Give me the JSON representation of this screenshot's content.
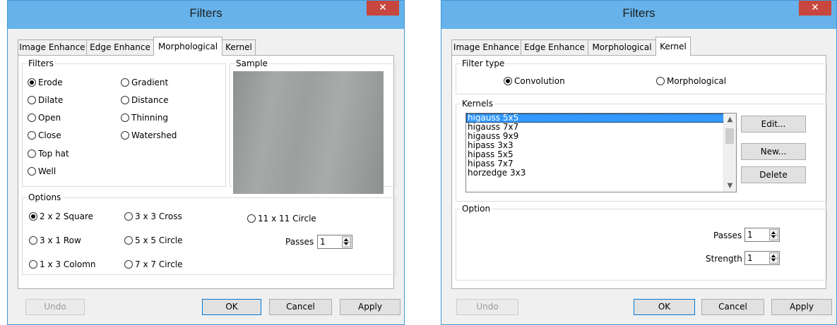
{
  "left_dialog": {
    "title": "Filters",
    "close_glyph": "✕",
    "tabs": [
      {
        "label": "Image Enhance",
        "active": false
      },
      {
        "label": "Edge Enhance",
        "active": false
      },
      {
        "label": "Morphological",
        "active": true
      },
      {
        "label": "Kernel",
        "active": false
      }
    ],
    "filters_group": {
      "title": "Filters",
      "options": [
        {
          "label": "Erode",
          "selected": true
        },
        {
          "label": "Dilate",
          "selected": false
        },
        {
          "label": "Open",
          "selected": false
        },
        {
          "label": "Close",
          "selected": false
        },
        {
          "label": "Top hat",
          "selected": false
        },
        {
          "label": "Well",
          "selected": false
        },
        {
          "label": "Gradient",
          "selected": false
        },
        {
          "label": "Distance",
          "selected": false
        },
        {
          "label": "Thinning",
          "selected": false
        },
        {
          "label": "Watershed",
          "selected": false
        }
      ]
    },
    "sample_group": {
      "title": "Sample"
    },
    "options_group": {
      "title": "Options",
      "options": [
        {
          "label": "2 x 2 Square",
          "selected": true
        },
        {
          "label": "3 x 1 Row",
          "selected": false
        },
        {
          "label": "1 x 3 Colomn",
          "selected": false
        },
        {
          "label": "3 x 3 Cross",
          "selected": false
        },
        {
          "label": "5 x 5 Circle",
          "selected": false
        },
        {
          "label": "7 x 7 Circle",
          "selected": false
        },
        {
          "label": "11 x 11 Circle",
          "selected": false
        }
      ],
      "passes_label": "Passes",
      "passes_value": "1"
    },
    "buttons": {
      "undo": "Undo",
      "ok": "OK",
      "cancel": "Cancel",
      "apply": "Apply"
    }
  },
  "right_dialog": {
    "title": "Filters",
    "close_glyph": "✕",
    "tabs": [
      {
        "label": "Image Enhance",
        "active": false
      },
      {
        "label": "Edge Enhance",
        "active": false
      },
      {
        "label": "Morphological",
        "active": false
      },
      {
        "label": "Kernel",
        "active": true
      }
    ],
    "filter_type_group": {
      "title": "Filter type",
      "options": [
        {
          "label": "Convolution",
          "selected": true
        },
        {
          "label": "Morphological",
          "selected": false
        }
      ]
    },
    "kernels_group": {
      "title": "Kernels",
      "items": [
        "higauss 5x5",
        "higauss 7x7",
        "higauss 9x9",
        "hipass 3x3",
        "hipass 5x5",
        "hipass 7x7",
        "horzedge 3x3"
      ],
      "selected_index": 0,
      "buttons": {
        "edit": "Edit...",
        "new": "New...",
        "delete": "Delete"
      }
    },
    "option_group": {
      "title": "Option",
      "passes_label": "Passes",
      "passes_value": "1",
      "strength_label": "Strength",
      "strength_value": "1"
    },
    "buttons": {
      "undo": "Undo",
      "ok": "OK",
      "cancel": "Cancel",
      "apply": "Apply"
    }
  }
}
